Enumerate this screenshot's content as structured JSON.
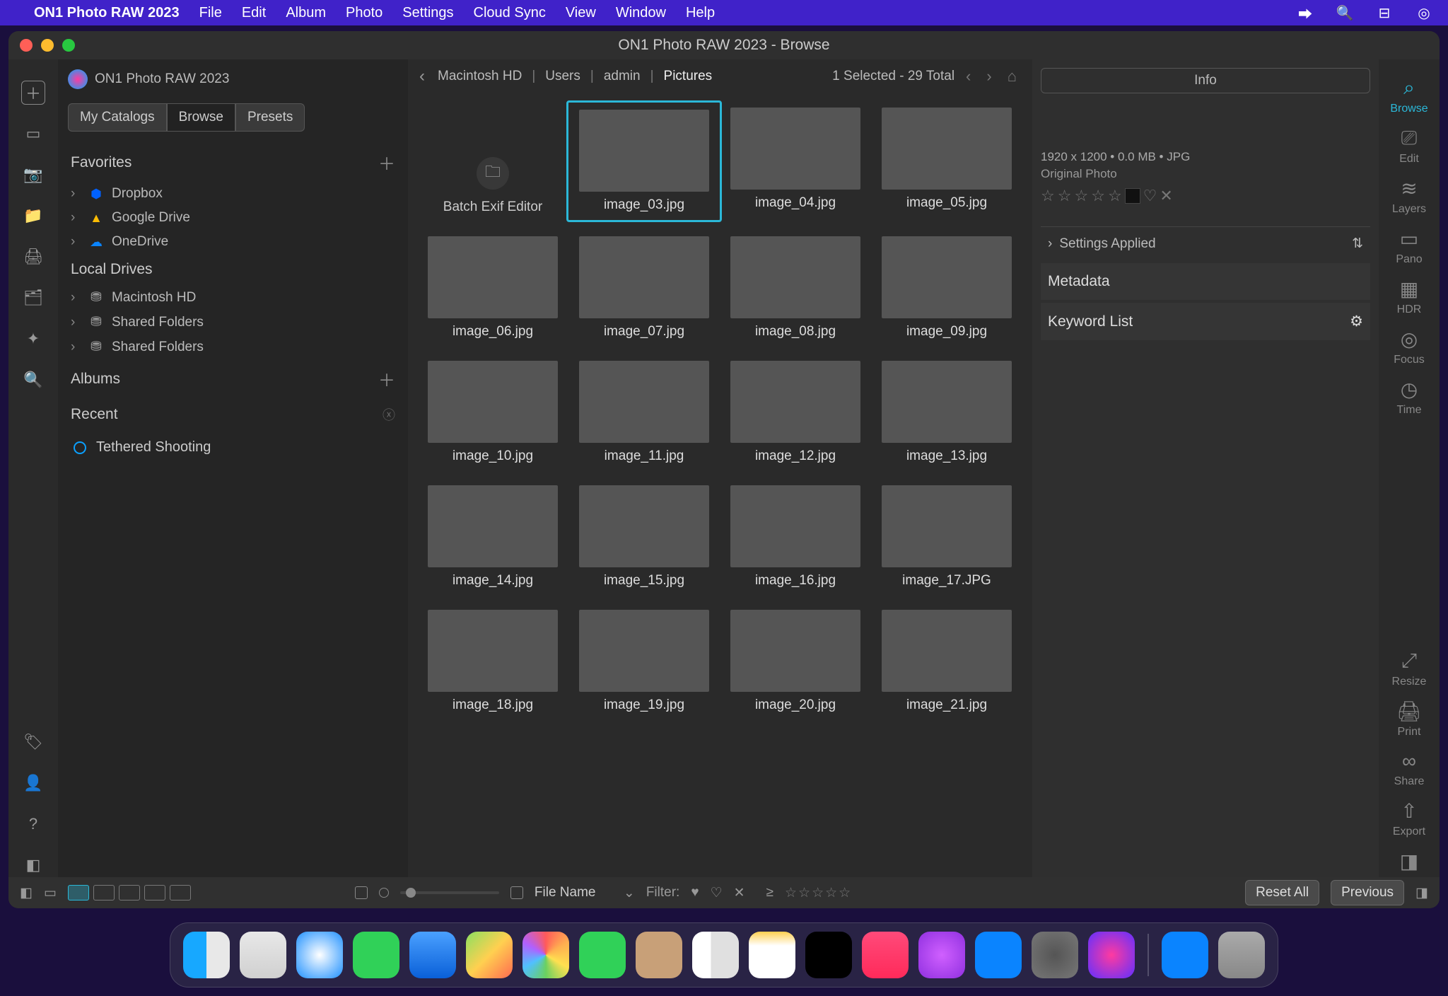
{
  "menubar": {
    "app": "ON1 Photo RAW 2023",
    "items": [
      "File",
      "Edit",
      "Album",
      "Photo",
      "Settings",
      "Cloud Sync",
      "View",
      "Window",
      "Help"
    ]
  },
  "window": {
    "title": "ON1 Photo RAW 2023 - Browse"
  },
  "sidebar": {
    "app_label": "ON1 Photo RAW 2023",
    "tabs": [
      "My Catalogs",
      "Browse",
      "Presets"
    ],
    "active_tab": 1,
    "favorites_label": "Favorites",
    "favorites": [
      "Dropbox",
      "Google Drive",
      "OneDrive"
    ],
    "local_label": "Local Drives",
    "local": [
      "Macintosh HD",
      "Shared Folders",
      "Shared Folders"
    ],
    "albums_label": "Albums",
    "recent_label": "Recent",
    "tethered_label": "Tethered Shooting"
  },
  "crumbs": {
    "parts": [
      "Macintosh HD",
      "Users",
      "admin",
      "Pictures"
    ],
    "status": "1 Selected - 29 Total"
  },
  "batch_label": "Batch Exif Editor",
  "thumbs": [
    {
      "cap": "image_03.jpg",
      "cls": "im3",
      "sel": true
    },
    {
      "cap": "image_04.jpg",
      "cls": "im4"
    },
    {
      "cap": "image_05.jpg",
      "cls": "im5"
    },
    {
      "cap": "image_06.jpg",
      "cls": "im6"
    },
    {
      "cap": "image_07.jpg",
      "cls": "im7"
    },
    {
      "cap": "image_08.jpg",
      "cls": "im8"
    },
    {
      "cap": "image_09.jpg",
      "cls": "im9"
    },
    {
      "cap": "image_10.jpg",
      "cls": "im10"
    },
    {
      "cap": "image_11.jpg",
      "cls": "im11"
    },
    {
      "cap": "image_12.jpg",
      "cls": "im12"
    },
    {
      "cap": "image_13.jpg",
      "cls": "im13"
    },
    {
      "cap": "image_14.jpg",
      "cls": "im14"
    },
    {
      "cap": "image_15.jpg",
      "cls": "im15"
    },
    {
      "cap": "image_16.jpg",
      "cls": "im16"
    },
    {
      "cap": "image_17.JPG",
      "cls": "im17"
    },
    {
      "cap": "image_18.jpg",
      "cls": "im18"
    },
    {
      "cap": "image_19.jpg",
      "cls": "im19"
    },
    {
      "cap": "image_20.jpg",
      "cls": "im20"
    },
    {
      "cap": "image_21.jpg",
      "cls": "im21"
    }
  ],
  "info": {
    "title": "Info",
    "meta": "1920 x 1200  •  0.0 MB  •  JPG",
    "original": "Original Photo",
    "settings_applied": "Settings Applied",
    "metadata": "Metadata",
    "keyword": "Keyword List"
  },
  "rtools": {
    "top": [
      "Browse",
      "Edit",
      "Layers",
      "Pano",
      "HDR",
      "Focus",
      "Time"
    ],
    "bottom": [
      "Resize",
      "Print",
      "Share",
      "Export"
    ]
  },
  "footer": {
    "filename_label": "File Name",
    "filter_label": "Filter:",
    "reset": "Reset All",
    "previous": "Previous"
  }
}
